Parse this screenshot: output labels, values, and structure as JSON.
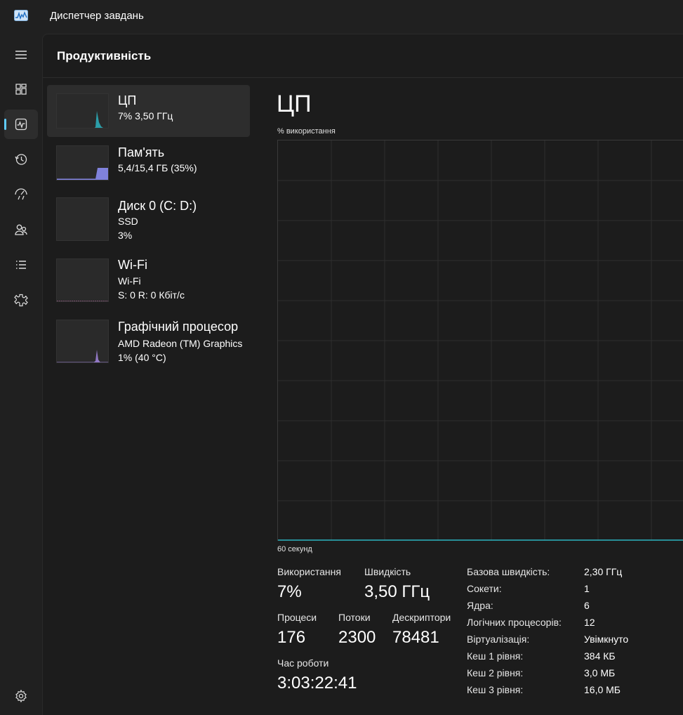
{
  "window": {
    "title": "Диспетчер завдань"
  },
  "nav": {
    "items": [
      {
        "icon": "hamburger-menu-icon"
      },
      {
        "icon": "processes-icon"
      },
      {
        "icon": "performance-icon",
        "active": true
      },
      {
        "icon": "app-history-icon"
      },
      {
        "icon": "startup-apps-icon"
      },
      {
        "icon": "users-icon"
      },
      {
        "icon": "details-icon"
      },
      {
        "icon": "services-icon"
      },
      {
        "icon": "settings-icon"
      }
    ]
  },
  "page": {
    "title": "Продуктивність"
  },
  "resources": [
    {
      "name": "ЦП",
      "line1": "7%  3,50 ГГц",
      "line2": "",
      "color": "#2bb3c0",
      "selected": true
    },
    {
      "name": "Пам'ять",
      "line1": "5,4/15,4 ГБ (35%)",
      "line2": "",
      "color": "#8a8cf0",
      "selected": false
    },
    {
      "name": "Диск 0 (C: D:)",
      "line1": "SSD",
      "line2": "3%",
      "color": "#4fb36d",
      "selected": false
    },
    {
      "name": "Wi-Fi",
      "line1": "Wi-Fi",
      "line2": "S: 0 R: 0 Кбіт/с",
      "color": "#c06aa6",
      "selected": false
    },
    {
      "name": "Графічний процесор",
      "line1": "AMD Radeon (TM) Graphics",
      "line2": "1%  (40 °C)",
      "color": "#9b7fd4",
      "selected": false
    }
  ],
  "detail": {
    "title": "ЦП",
    "y_axis_label": "% використання",
    "x_axis_label": "60 секунд",
    "accent_color": "#2bb3c0",
    "stats": {
      "usage_label": "Використання",
      "usage_value": "7%",
      "speed_label": "Швидкість",
      "speed_value": "3,50 ГГц",
      "processes_label": "Процеси",
      "processes_value": "176",
      "threads_label": "Потоки",
      "threads_value": "2300",
      "handles_label": "Дескриптори",
      "handles_value": "78481",
      "uptime_label": "Час роботи",
      "uptime_value": "3:03:22:41"
    },
    "info": [
      {
        "key": "Базова швидкість:",
        "value": "2,30 ГГц"
      },
      {
        "key": "Сокети:",
        "value": "1"
      },
      {
        "key": "Ядра:",
        "value": "6"
      },
      {
        "key": "Логічних процесорів:",
        "value": "12"
      },
      {
        "key": "Віртуалізація:",
        "value": "Увімкнуто"
      },
      {
        "key": "Кеш 1 рівня:",
        "value": "384 КБ"
      },
      {
        "key": "Кеш 2 рівня:",
        "value": "3,0 МБ"
      },
      {
        "key": "Кеш 3 рівня:",
        "value": "16,0 МБ"
      }
    ]
  }
}
